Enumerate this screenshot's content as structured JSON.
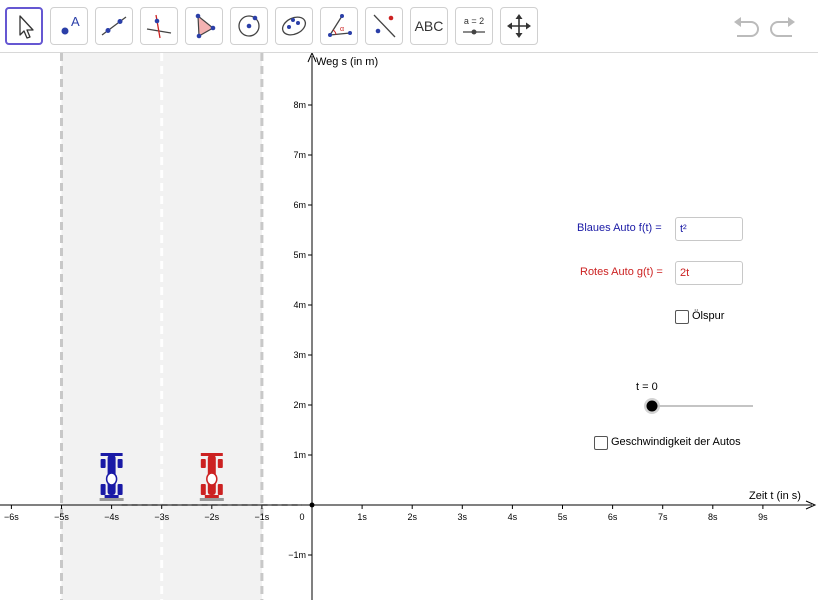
{
  "toolbar": {
    "tools": [
      {
        "name": "move-tool",
        "label": ""
      },
      {
        "name": "point-tool",
        "label": ""
      },
      {
        "name": "line-tool",
        "label": ""
      },
      {
        "name": "perpendicular-line-tool",
        "label": ""
      },
      {
        "name": "polygon-tool",
        "label": ""
      },
      {
        "name": "circle-tool",
        "label": ""
      },
      {
        "name": "ellipse-tool",
        "label": ""
      },
      {
        "name": "angle-tool",
        "label": ""
      },
      {
        "name": "reflect-tool",
        "label": ""
      },
      {
        "name": "text-tool",
        "label": "ABC"
      },
      {
        "name": "slider-tool",
        "label": "a = 2"
      },
      {
        "name": "move-graphics-tool",
        "label": ""
      }
    ],
    "undo_icon": "undo-icon",
    "redo_icon": "redo-icon"
  },
  "graph": {
    "y_axis_label": "Weg s (in m)",
    "x_axis_label": "Zeit t (in s)",
    "x_ticks": [
      "−6s",
      "−5s",
      "−4s",
      "−3s",
      "−2s",
      "−1s",
      "0",
      "1s",
      "2s",
      "3s",
      "4s",
      "5s",
      "6s",
      "7s",
      "8s",
      "9s"
    ],
    "y_ticks": [
      "8m",
      "7m",
      "6m",
      "5m",
      "4m",
      "3m",
      "2m",
      "1m",
      "−1m"
    ],
    "x_range": [
      -6.2,
      10
    ],
    "y_range": [
      -1.8,
      9
    ]
  },
  "inputs": {
    "blue_label": "Blaues Auto f(t) =",
    "blue_value": "t²",
    "red_label": "Rotes Auto g(t) =",
    "red_value": "2t"
  },
  "checkboxes": {
    "oilspur_label": "Ölspur",
    "speed_label": "Geschwindigkeit der Autos"
  },
  "slider": {
    "label": "t = 0",
    "value": 0
  },
  "colors": {
    "blue": "#1a1aa6",
    "red": "#cc2222",
    "track": "#f2f2f2"
  }
}
